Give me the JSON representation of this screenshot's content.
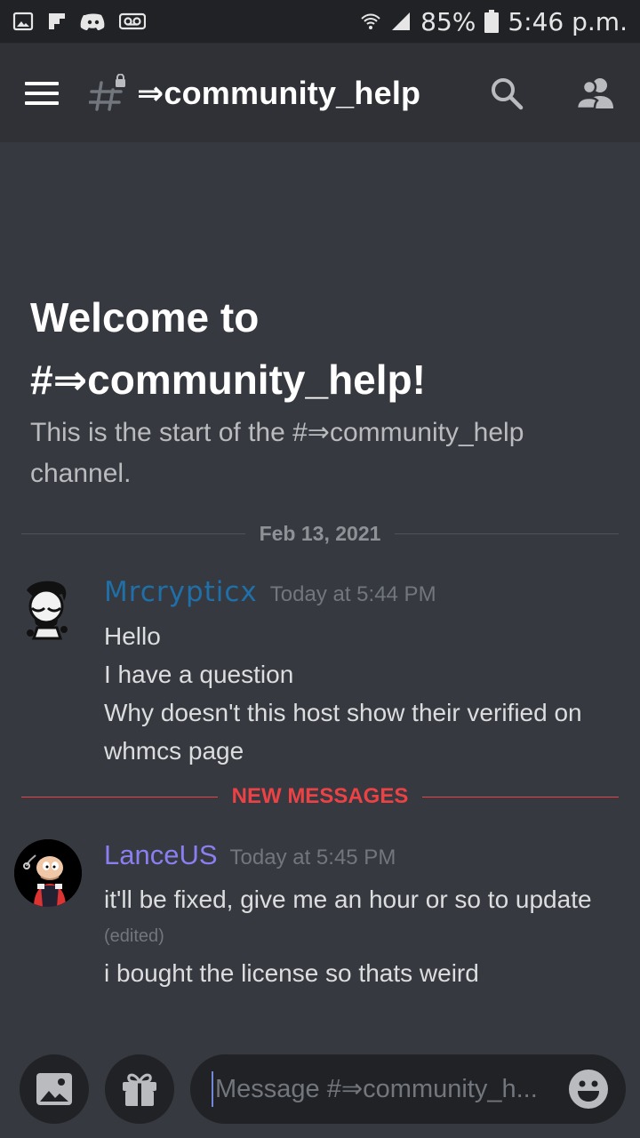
{
  "status_bar": {
    "battery": "85%",
    "time": "5:46 p.m.",
    "left_icons": [
      "gallery-icon",
      "flipboard-icon",
      "discord-icon",
      "voicemail-icon"
    ],
    "right_icons": [
      "wifi-icon",
      "signal-icon",
      "battery-icon"
    ]
  },
  "header": {
    "channel_name": "⇒community_help",
    "icons": [
      "menu-icon",
      "locked-channel-icon",
      "search-icon",
      "members-icon"
    ]
  },
  "welcome": {
    "title_line1": "Welcome to",
    "title_line2": "#⇒community_help!",
    "description": "This is the start of the #⇒community_help channel."
  },
  "date_divider": "Feb 13, 2021",
  "new_messages_divider": "NEW MESSAGES",
  "messages": [
    {
      "author": "Mrcrypticx",
      "author_color": "#1f6fa8",
      "timestamp": "Today at 5:44 PM",
      "lines": [
        "Hello",
        "I have a question",
        "Why doesn't this host show their verified on whmcs page"
      ]
    },
    {
      "author": "LanceUS",
      "author_color": "#8a7ff0",
      "timestamp": "Today at 5:45 PM",
      "lines": [
        "it'll be fixed, give me an hour or so to update"
      ],
      "edited_label": "(edited)",
      "lines_after": [
        "i bought the license so thats weird"
      ]
    }
  ],
  "composer": {
    "placeholder": "Message #⇒community_h...",
    "buttons": [
      "image-upload-icon",
      "gift-icon",
      "emoji-icon"
    ]
  },
  "colors": {
    "background": "#36393f",
    "header": "#2f3136",
    "status_bar": "#202225",
    "new_messages": "#ed4245"
  }
}
